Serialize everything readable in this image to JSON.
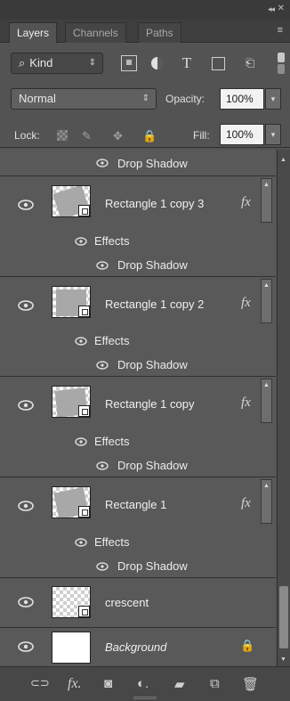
{
  "panel": {
    "collapse_glyph": "◂◂",
    "close_glyph": "✕",
    "tabs": [
      {
        "label": "Layers",
        "active": true
      },
      {
        "label": "Channels",
        "active": false
      },
      {
        "label": "Paths",
        "active": false
      }
    ],
    "menu_glyph": "≡"
  },
  "filter": {
    "kind_icon": "⌕",
    "kind_label": "Kind",
    "spin_glyph": "⇕",
    "icons": [
      "pixel-filter-icon",
      "adjustment-filter-icon",
      "type-filter-icon",
      "shape-filter-icon",
      "smart-object-filter-icon"
    ],
    "pixel_glyph": "▦",
    "type_glyph": "T",
    "smart_glyph": "⎗"
  },
  "blend": {
    "mode": "Normal",
    "spin_glyph": "⇕",
    "opacity_label": "Opacity:",
    "opacity_value": "100%",
    "arrow_glyph": "▾"
  },
  "lock": {
    "label": "Lock:",
    "fill_label": "Fill:",
    "fill_value": "100%",
    "brush_glyph": "✎",
    "move_glyph": "✥",
    "lock_glyph": "🔒"
  },
  "layers": {
    "effects_label": "Effects",
    "drop_shadow_label": "Drop Shadow",
    "fx_label": "fx",
    "toggle_glyph": "▲",
    "items": [
      {
        "name": "Rectangle 1 copy 3",
        "has_fx": true
      },
      {
        "name": "Rectangle 1 copy 2",
        "has_fx": true
      },
      {
        "name": "Rectangle 1 copy",
        "has_fx": true
      },
      {
        "name": "Rectangle 1",
        "has_fx": true
      },
      {
        "name": "crescent",
        "has_fx": false
      },
      {
        "name": "Background",
        "has_fx": false,
        "locked": true
      }
    ],
    "colors": {
      "crescent": "#ff0000",
      "rectangle": "#a8a8a8"
    }
  },
  "scroll": {
    "up_glyph": "▲",
    "down_glyph": "▼"
  },
  "bottom": {
    "link_glyph": "⊂⊃",
    "fx_glyph": "fx.",
    "mask_glyph": "◙",
    "adjust_glyph": "◐.",
    "folder_glyph": "▰",
    "new_glyph": "⧉",
    "delete_glyph": "🗑"
  }
}
